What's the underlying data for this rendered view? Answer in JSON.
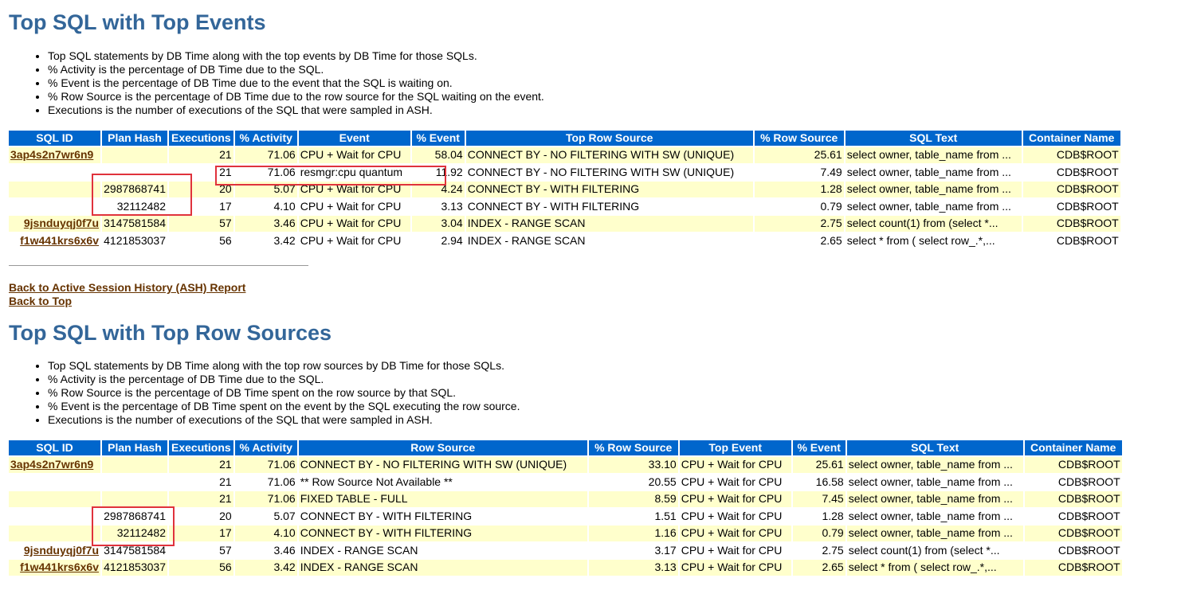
{
  "sectionA": {
    "title": "Top SQL with Top Events",
    "notes": [
      "Top SQL statements by DB Time along with the top events by DB Time for those SQLs.",
      "% Activity is the percentage of DB Time due to the SQL.",
      "% Event is the percentage of DB Time due to the event that the SQL is waiting on.",
      "% Row Source is the percentage of DB Time due to the row source for the SQL waiting on the event.",
      "Executions is the number of executions of the SQL that were sampled in ASH."
    ],
    "headers": [
      "SQL ID",
      "Plan Hash",
      "Executions",
      "% Activity",
      "Event",
      "% Event",
      "Top Row Source",
      "% Row Source",
      "SQL Text",
      "Container Name"
    ],
    "rows": [
      [
        "3ap4s2n7wr6n9",
        "",
        "21",
        "71.06",
        "CPU + Wait for CPU",
        "58.04",
        "CONNECT BY - NO FILTERING WITH SW (UNIQUE)",
        "25.61",
        "select owner, table_name from ...",
        "CDB$ROOT"
      ],
      [
        "",
        "",
        "21",
        "71.06",
        "resmgr:cpu quantum",
        "11.92",
        "CONNECT BY - NO FILTERING WITH SW (UNIQUE)",
        "7.49",
        "select owner, table_name from ...",
        "CDB$ROOT"
      ],
      [
        "",
        "2987868741",
        "20",
        "5.07",
        "CPU + Wait for CPU",
        "4.24",
        "CONNECT BY - WITH FILTERING",
        "1.28",
        "select owner, table_name from ...",
        "CDB$ROOT"
      ],
      [
        "",
        "32112482",
        "17",
        "4.10",
        "CPU + Wait for CPU",
        "3.13",
        "CONNECT BY - WITH FILTERING",
        "0.79",
        "select owner, table_name from ...",
        "CDB$ROOT"
      ],
      [
        "9jsnduyqj0f7u",
        "3147581584",
        "57",
        "3.46",
        "CPU + Wait for CPU",
        "3.04",
        "INDEX - RANGE SCAN",
        "2.75",
        "select count(1) from (select *...",
        "CDB$ROOT"
      ],
      [
        "f1w441krs6x6v",
        "4121853037",
        "56",
        "3.42",
        "CPU + Wait for CPU",
        "2.94",
        "INDEX - RANGE SCAN",
        "2.65",
        "select * from ( select row_.*,...",
        "CDB$ROOT"
      ]
    ]
  },
  "links": {
    "back_ash": "Back to Active Session History (ASH) Report",
    "back_top": "Back to Top"
  },
  "sectionB": {
    "title": "Top SQL with Top Row Sources",
    "notes": [
      "Top SQL statements by DB Time along with the top row sources by DB Time for those SQLs.",
      "% Activity is the percentage of DB Time due to the SQL.",
      "% Row Source is the percentage of DB Time spent on the row source by that SQL.",
      "% Event is the percentage of DB Time spent on the event by the SQL executing the row source.",
      "Executions is the number of executions of the SQL that were sampled in ASH."
    ],
    "headers": [
      "SQL ID",
      "Plan Hash",
      "Executions",
      "% Activity",
      "Row Source",
      "% Row Source",
      "Top Event",
      "% Event",
      "SQL Text",
      "Container Name"
    ],
    "rows": [
      [
        "3ap4s2n7wr6n9",
        "",
        "21",
        "71.06",
        "CONNECT BY - NO FILTERING WITH SW (UNIQUE)",
        "33.10",
        "CPU + Wait for CPU",
        "25.61",
        "select owner, table_name from ...",
        "CDB$ROOT"
      ],
      [
        "",
        "",
        "21",
        "71.06",
        "** Row Source Not Available **",
        "20.55",
        "CPU + Wait for CPU",
        "16.58",
        "select owner, table_name from ...",
        "CDB$ROOT"
      ],
      [
        "",
        "",
        "21",
        "71.06",
        "FIXED TABLE - FULL",
        "8.59",
        "CPU + Wait for CPU",
        "7.45",
        "select owner, table_name from ...",
        "CDB$ROOT"
      ],
      [
        "",
        "2987868741",
        "20",
        "5.07",
        "CONNECT BY - WITH FILTERING",
        "1.51",
        "CPU + Wait for CPU",
        "1.28",
        "select owner, table_name from ...",
        "CDB$ROOT"
      ],
      [
        "",
        "32112482",
        "17",
        "4.10",
        "CONNECT BY - WITH FILTERING",
        "1.16",
        "CPU + Wait for CPU",
        "0.79",
        "select owner, table_name from ...",
        "CDB$ROOT"
      ],
      [
        "9jsnduyqj0f7u",
        "3147581584",
        "57",
        "3.46",
        "INDEX - RANGE SCAN",
        "3.17",
        "CPU + Wait for CPU",
        "2.75",
        "select count(1) from (select *...",
        "CDB$ROOT"
      ],
      [
        "f1w441krs6x6v",
        "4121853037",
        "56",
        "3.42",
        "INDEX - RANGE SCAN",
        "3.13",
        "CPU + Wait for CPU",
        "2.65",
        "select * from ( select row_.*,...",
        "CDB$ROOT"
      ]
    ]
  },
  "colors": {
    "heading": "#336699",
    "header_bg": "#0066cc",
    "row_alt": "#ffffcc",
    "link": "#663300",
    "highlight_box": "#e0323c"
  }
}
